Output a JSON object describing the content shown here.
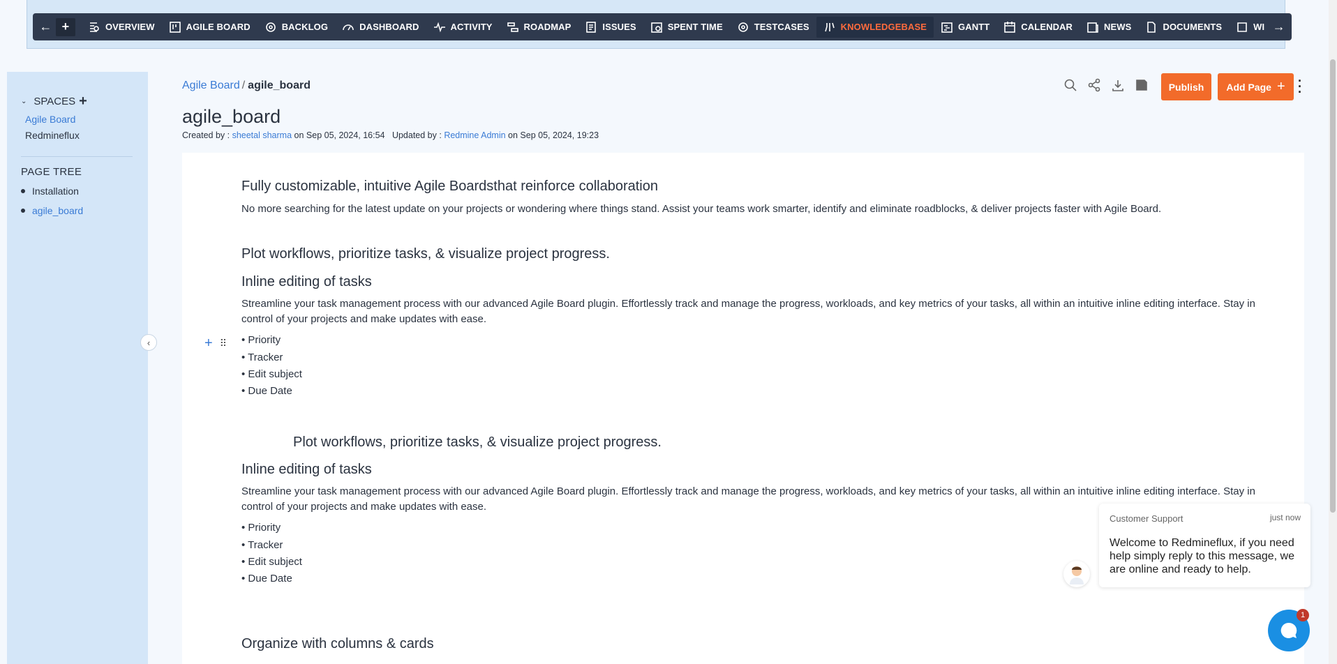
{
  "nav": {
    "back": "←",
    "add": "+",
    "forward": "→",
    "items": [
      {
        "label": "OVERVIEW",
        "icon": "overview-icon"
      },
      {
        "label": "AGILE BOARD",
        "icon": "agile-board-icon"
      },
      {
        "label": "BACKLOG",
        "icon": "backlog-icon"
      },
      {
        "label": "DASHBOARD",
        "icon": "dashboard-icon"
      },
      {
        "label": "ACTIVITY",
        "icon": "activity-icon"
      },
      {
        "label": "ROADMAP",
        "icon": "roadmap-icon"
      },
      {
        "label": "ISSUES",
        "icon": "issues-icon"
      },
      {
        "label": "SPENT TIME",
        "icon": "spent-time-icon"
      },
      {
        "label": "TESTCASES",
        "icon": "testcases-icon"
      },
      {
        "label": "KNOWLEDGEBASE",
        "icon": "knowledgebase-icon",
        "active": true
      },
      {
        "label": "GANTT",
        "icon": "gantt-icon"
      },
      {
        "label": "CALENDAR",
        "icon": "calendar-icon"
      },
      {
        "label": "NEWS",
        "icon": "news-icon"
      },
      {
        "label": "DOCUMENTS",
        "icon": "documents-icon"
      },
      {
        "label": "WI",
        "icon": "wiki-icon"
      }
    ],
    "active_color": "#ff6b3d"
  },
  "sidebar": {
    "spaces_label": "SPACES",
    "spaces": [
      "Agile Board",
      "Redmineflux"
    ],
    "page_tree_label": "PAGE TREE",
    "tree": [
      "Installation",
      "agile_board"
    ]
  },
  "header": {
    "breadcrumb_parent": "Agile Board",
    "breadcrumb_sep": "/",
    "breadcrumb_current": "agile_board",
    "title": "agile_board",
    "created_by_label": "Created by :",
    "created_by": "sheetal sharma",
    "created_on": "on Sep 05, 2024, 16:54",
    "updated_by_label": "Updated by :",
    "updated_by": "Redmine Admin",
    "updated_on": "on Sep 05, 2024, 19:23",
    "publish": "Publish",
    "add_page": "Add Page",
    "accent": "#f26b2a"
  },
  "content": {
    "h1": "Fully customizable, intuitive Agile Boardsthat reinforce collaboration",
    "p1": "No more searching for the latest update on your projects or wondering where things stand. Assist your teams work smarter, identify and eliminate roadblocks, & deliver projects faster with Agile Board.",
    "h2": "Plot workflows, prioritize tasks, & visualize project progress.",
    "h3": "Inline editing of tasks",
    "p2": "Streamline your task management process with our advanced Agile Board plugin. Effortlessly track and manage the progress, workloads, and key metrics of your tasks, all within an intuitive inline editing interface. Stay in control of your projects and make updates with ease.",
    "list1": [
      "• Priority",
      "• Tracker",
      "• Edit subject",
      "• Due Date"
    ],
    "h4": "Plot workflows, prioritize tasks, & visualize project progress.",
    "h5": "Inline editing of tasks",
    "p3": "Streamline your task management process with our advanced Agile Board plugin. Effortlessly track and manage the progress, workloads, and key metrics of your tasks, all within an intuitive inline editing interface. Stay in control of your projects and make updates with ease.",
    "list2": [
      "• Priority",
      "• Tracker",
      "• Edit subject",
      "• Due Date"
    ],
    "h6": "Organize with columns & cards"
  },
  "chat": {
    "from": "Customer Support",
    "time": "just now",
    "message": "Welcome to Redmineflux, if you need help simply reply to this message, we are online and ready to help.",
    "badge": "1"
  }
}
